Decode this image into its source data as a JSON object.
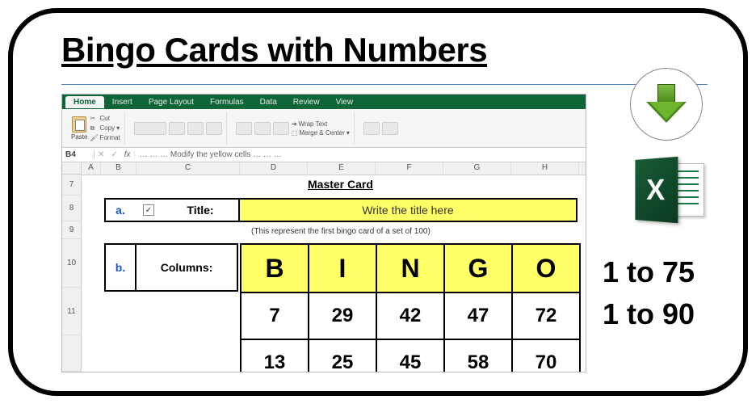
{
  "page": {
    "title": "Bingo Cards with Numbers",
    "range1": "1 to 75",
    "range2": "1 to 90"
  },
  "excel": {
    "tabs": [
      "Home",
      "Insert",
      "Page Layout",
      "Formulas",
      "Data",
      "Review",
      "View"
    ],
    "clipboard": {
      "paste": "Paste",
      "cut": "Cut",
      "copy": "Copy",
      "format": "Format"
    },
    "align": {
      "wrap": "Wrap Text",
      "merge": "Merge & Center"
    },
    "name_box": "B4",
    "fx": "fx",
    "formula_text": "… … … Modify the yellow cells … … …",
    "cols": [
      "A",
      "B",
      "C",
      "D",
      "E",
      "F",
      "G",
      "H"
    ],
    "rows": [
      "7",
      "8",
      "9",
      "10",
      "11"
    ]
  },
  "sheet": {
    "master": "Master Card",
    "a_label": "a.",
    "checkbox": "✓",
    "title_label": "Title:",
    "title_value": "Write the title here",
    "subnote": "(This represent the first bingo card of a set of 100)",
    "b_label": "b.",
    "columns_label": "Columns:",
    "bingo_head": [
      "B",
      "I",
      "N",
      "G",
      "O"
    ],
    "bingo_rows": [
      [
        "7",
        "29",
        "42",
        "47",
        "72"
      ],
      [
        "13",
        "25",
        "45",
        "58",
        "70"
      ]
    ]
  },
  "icons": {
    "download": "download-arrow",
    "excel_x": "X"
  }
}
